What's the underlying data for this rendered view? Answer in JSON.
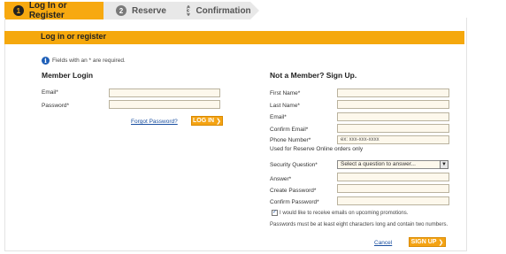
{
  "steps": [
    {
      "num": "1",
      "label": "Log In or Register"
    },
    {
      "num": "2",
      "label": "Reserve"
    },
    {
      "num": "3",
      "label": "Confirmation"
    }
  ],
  "panel": {
    "title": "Log in or register"
  },
  "note": {
    "icon": "info-icon",
    "text": "Fields with an * are required."
  },
  "member_login": {
    "title": "Member Login",
    "email_label": "Email*",
    "email_value": "",
    "password_label": "Password*",
    "password_value": "",
    "forgot_label": "Forgot Password?",
    "login_button": "LOG IN",
    "login_arrow": "❯"
  },
  "signup": {
    "title": "Not a Member? Sign Up.",
    "first_name_label": "First Name*",
    "last_name_label": "Last Name*",
    "email_label": "Email*",
    "confirm_email_label": "Confirm Email*",
    "phone_label": "Phone Number*",
    "phone_placeholder": "ex: xxx-xxx-xxxx",
    "phone_hint": "Used for Reserve Online orders only",
    "security_question_label": "Security Question*",
    "security_question_value": "Select a question to answer...",
    "answer_label": "Answer*",
    "create_password_label": "Create Password*",
    "confirm_password_label": "Confirm Password*",
    "optin_text": "I would like to receive emails on upcoming promotions.",
    "optin_checked": true,
    "password_rule": "Passwords must be at least eight characters long and contain two numbers.",
    "cancel_label": "Cancel",
    "signup_button": "SIGN UP",
    "signup_arrow": "❯"
  },
  "colors": {
    "accent": "#f5a80d",
    "link": "#1a4fa0",
    "input_bg": "#fdf8ec"
  }
}
